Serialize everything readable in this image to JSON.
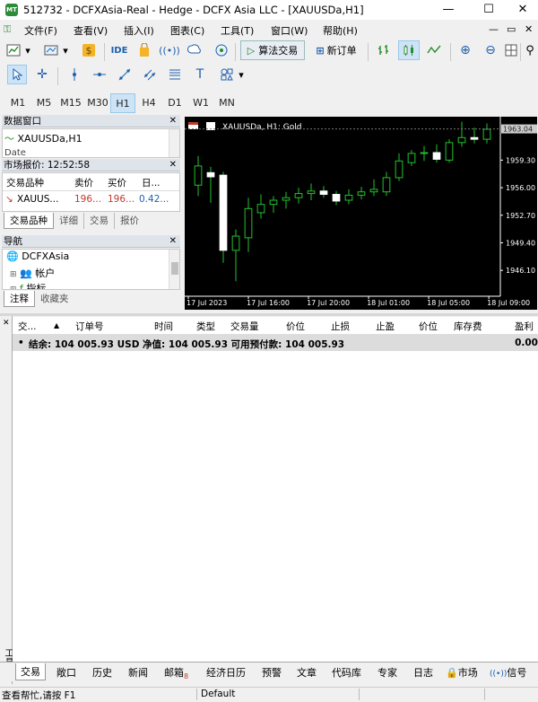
{
  "window": {
    "title": "512732 - DCFXAsia-Real - Hedge - DCFX Asia LLC - [XAUUSDa,H1]",
    "minimize": "—",
    "maximize": "☐",
    "close": "✕"
  },
  "menu": [
    "文件(F)",
    "查看(V)",
    "插入(I)",
    "图表(C)",
    "工具(T)",
    "窗口(W)",
    "帮助(H)"
  ],
  "toolbar": {
    "ide": "IDE",
    "algo_trading": "算法交易",
    "new_order": "新订单"
  },
  "timeframes": [
    "M1",
    "M5",
    "M15",
    "M30",
    "H1",
    "H4",
    "D1",
    "W1",
    "MN"
  ],
  "selected_timeframe": "H1",
  "data_window": {
    "title": "数据窗口",
    "symbol": "XAUUSDa,H1",
    "row2": "Date"
  },
  "market_watch": {
    "title": "市场报价: 12:52:58",
    "headers": [
      "交易品种",
      "卖价",
      "买价",
      "日..."
    ],
    "row": {
      "symbol": "XAUUS...",
      "bid": "196...",
      "ask": "196...",
      "daily": "0.42..."
    },
    "tabs": [
      "交易品种",
      "详细",
      "交易",
      "报价"
    ]
  },
  "navigator": {
    "title": "导航",
    "items": [
      "DCFXAsia",
      "帐户",
      "指标"
    ],
    "tabs": [
      "注释",
      "收藏夹"
    ]
  },
  "chart": {
    "symbol_label": "XAUUSDa, H1:  Gold",
    "current_price": "1963.04",
    "price_color": "#1e1e1e"
  },
  "chart_data": {
    "type": "candlestick",
    "title": "XAUUSDa, H1:  Gold",
    "y_ticks": [
      "1959.30",
      "1956.00",
      "1952.70",
      "1949.40",
      "1946.10"
    ],
    "y_range": [
      1943.0,
      1964.5
    ],
    "x_labels": [
      "17 Jul 2023",
      "17 Jul 16:00",
      "17 Jul 20:00",
      "18 Jul 01:00",
      "18 Jul 05:00",
      "18 Jul 09:00"
    ],
    "candles": [
      {
        "o": 1956.3,
        "h": 1959.8,
        "l": 1955.0,
        "c": 1958.6
      },
      {
        "o": 1957.8,
        "h": 1958.5,
        "l": 1954.2,
        "c": 1957.3
      },
      {
        "o": 1957.5,
        "h": 1957.9,
        "l": 1947.0,
        "c": 1948.5
      },
      {
        "o": 1948.5,
        "h": 1951.0,
        "l": 1944.8,
        "c": 1950.2
      },
      {
        "o": 1950.0,
        "h": 1954.8,
        "l": 1948.3,
        "c": 1953.5
      },
      {
        "o": 1953.0,
        "h": 1955.2,
        "l": 1952.3,
        "c": 1954.0
      },
      {
        "o": 1954.0,
        "h": 1955.0,
        "l": 1953.0,
        "c": 1954.5
      },
      {
        "o": 1954.5,
        "h": 1955.5,
        "l": 1953.5,
        "c": 1954.8
      },
      {
        "o": 1954.8,
        "h": 1956.0,
        "l": 1954.1,
        "c": 1955.3
      },
      {
        "o": 1955.3,
        "h": 1956.5,
        "l": 1954.5,
        "c": 1955.6
      },
      {
        "o": 1955.6,
        "h": 1956.2,
        "l": 1954.8,
        "c": 1955.2
      },
      {
        "o": 1955.2,
        "h": 1955.6,
        "l": 1953.9,
        "c": 1954.4
      },
      {
        "o": 1954.5,
        "h": 1955.8,
        "l": 1954.0,
        "c": 1955.1
      },
      {
        "o": 1955.1,
        "h": 1956.1,
        "l": 1954.6,
        "c": 1955.5
      },
      {
        "o": 1955.5,
        "h": 1957.0,
        "l": 1955.0,
        "c": 1955.8
      },
      {
        "o": 1955.5,
        "h": 1957.9,
        "l": 1955.0,
        "c": 1957.2
      },
      {
        "o": 1957.2,
        "h": 1960.1,
        "l": 1956.8,
        "c": 1959.2
      },
      {
        "o": 1959.0,
        "h": 1960.5,
        "l": 1958.6,
        "c": 1960.1
      },
      {
        "o": 1960.1,
        "h": 1961.0,
        "l": 1959.2,
        "c": 1960.2
      },
      {
        "o": 1960.2,
        "h": 1961.2,
        "l": 1959.0,
        "c": 1959.4
      },
      {
        "o": 1959.3,
        "h": 1961.8,
        "l": 1959.0,
        "c": 1961.4
      },
      {
        "o": 1961.4,
        "h": 1963.9,
        "l": 1960.9,
        "c": 1962.0
      },
      {
        "o": 1962.0,
        "h": 1963.2,
        "l": 1961.3,
        "c": 1961.8
      },
      {
        "o": 1961.8,
        "h": 1963.7,
        "l": 1961.3,
        "c": 1963.0
      }
    ]
  },
  "trade_table": {
    "headers": [
      "交...",
      "订单号",
      "时间",
      "类型",
      "交易量",
      "价位",
      "止损",
      "止盈",
      "价位",
      "库存费",
      "盈利"
    ],
    "balance_line": "结余: 104 005.93 USD  净值: 104 005.93  可用预付款: 104 005.93",
    "profit": "0.00"
  },
  "sidebar_label": "工具箱",
  "bottom_tabs": [
    "交易",
    "敞口",
    "历史",
    "新闻",
    "邮箱",
    "经济日历",
    "预警",
    "文章",
    "代码库",
    "专家",
    "日志",
    "市场",
    "信号"
  ],
  "mailbox_badge": "8",
  "status": {
    "help": "查看帮忙,请按 F1",
    "profile": "Default"
  }
}
